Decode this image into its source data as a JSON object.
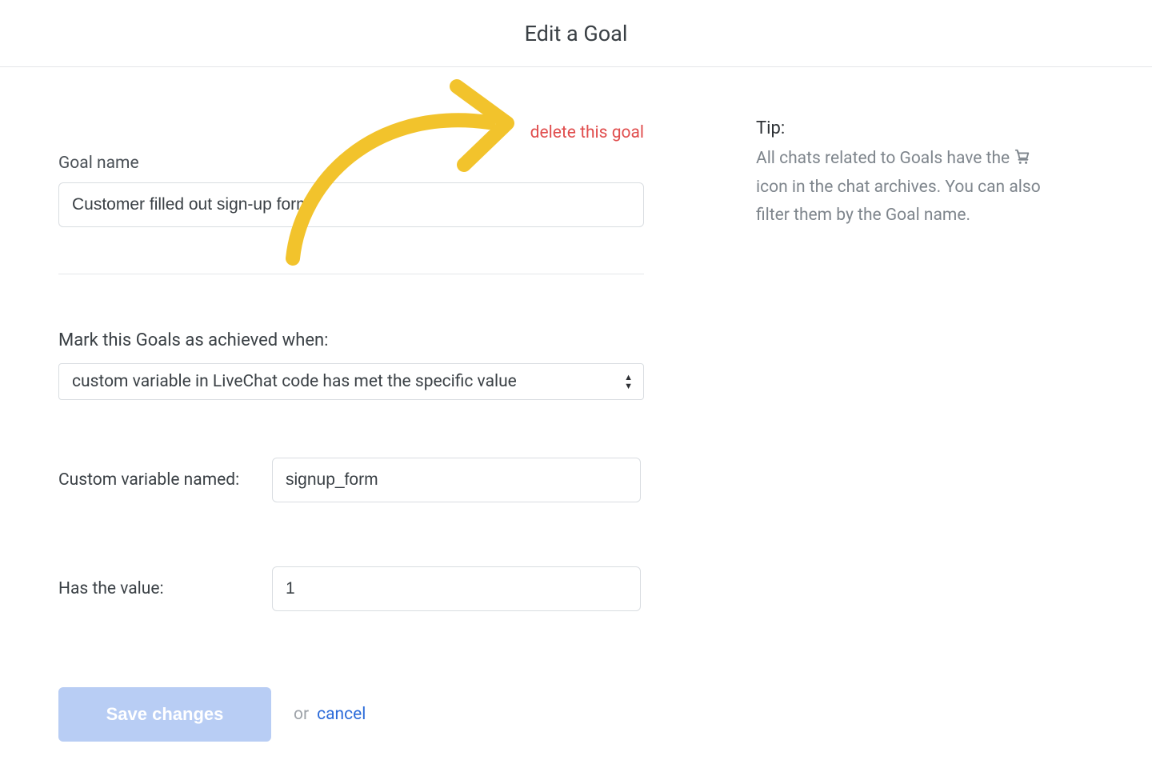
{
  "header": {
    "title": "Edit a Goal"
  },
  "form": {
    "delete_link": "delete this goal",
    "goal_name_label": "Goal name",
    "goal_name_value": "Customer filled out sign-up form",
    "achieved_label": "Mark this Goals as achieved when:",
    "achieved_select_value": "custom variable in LiveChat code has met the specific value",
    "custom_var_label": "Custom variable named:",
    "custom_var_value": "signup_form",
    "has_value_label": "Has the value:",
    "has_value_value": "1",
    "save_label": "Save changes",
    "or_label": "or",
    "cancel_label": "cancel"
  },
  "tip": {
    "heading": "Tip:",
    "body_before_icon": "All chats related to Goals have the ",
    "body_after_icon": " icon in the chat archives. You can also filter them by the Goal name.",
    "icon_name": "shopping-cart"
  },
  "annotation": {
    "arrow_color": "#f2c32c"
  }
}
